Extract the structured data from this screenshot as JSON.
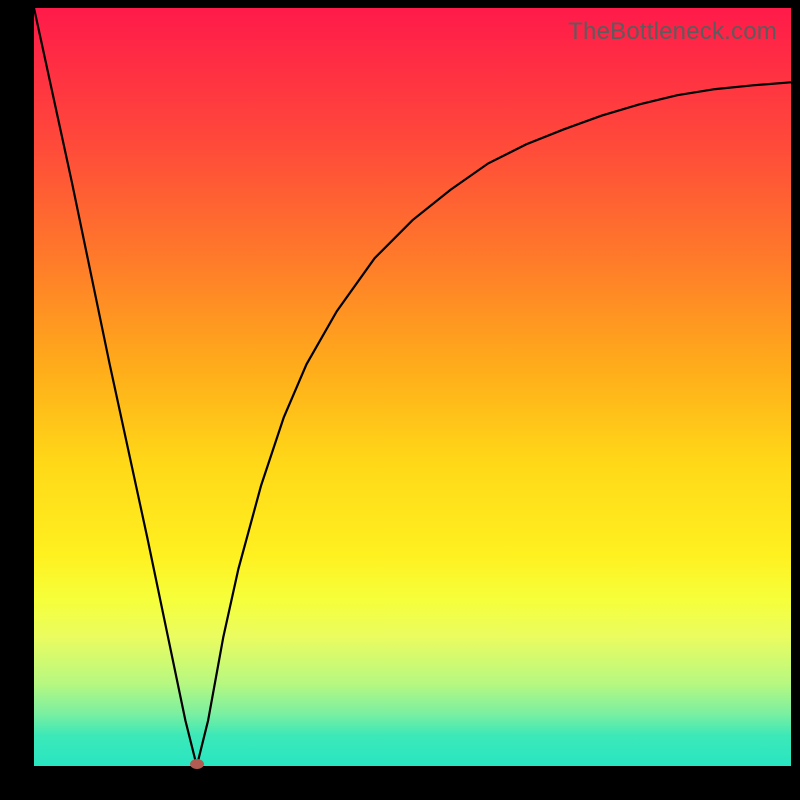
{
  "watermark": "TheBottleneck.com",
  "colors": {
    "frame": "#000000",
    "curve": "#000000",
    "dot": "#b15b52"
  },
  "chart_data": {
    "type": "line",
    "title": "",
    "xlabel": "",
    "ylabel": "",
    "xlim": [
      0,
      100
    ],
    "ylim": [
      0,
      100
    ],
    "series": [
      {
        "name": "curve",
        "x": [
          0,
          5,
          10,
          15,
          20,
          21.5,
          23,
          25,
          27,
          30,
          33,
          36,
          40,
          45,
          50,
          55,
          60,
          65,
          70,
          75,
          80,
          85,
          90,
          95,
          100
        ],
        "y": [
          100,
          77,
          53,
          30,
          6,
          0,
          6,
          17,
          26,
          37,
          46,
          53,
          60,
          67,
          72,
          76,
          79.5,
          82,
          84,
          85.8,
          87.3,
          88.5,
          89.3,
          89.8,
          90.2
        ]
      }
    ],
    "marker": {
      "x": 21.5,
      "y": 0
    },
    "background_gradient": {
      "top": "#ff1a4a",
      "bottom": "#28e6c2",
      "stops": [
        "#ff1a4a",
        "#ff7a2a",
        "#ffd818",
        "#f6ff3a",
        "#28e6c2"
      ]
    }
  }
}
